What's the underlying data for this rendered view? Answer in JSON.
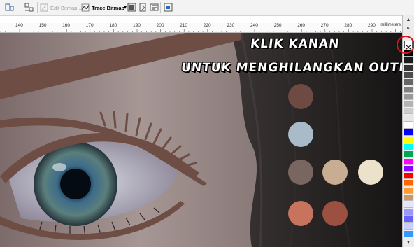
{
  "toolbar": {
    "edit_bitmap_label": "Edit Bitmap...",
    "trace_bitmap_label": "Trace Bitmap"
  },
  "ruler": {
    "labels": [
      "140",
      "150",
      "160",
      "170",
      "180",
      "190",
      "200",
      "210",
      "220",
      "230",
      "240",
      "250",
      "260",
      "270",
      "280",
      "290"
    ],
    "unit": "millimeters"
  },
  "canvas": {
    "headline_line1": "KLIK KANAN",
    "headline_line2": "UNTUK MENGHILANGKAN OUTLINE",
    "swatch_colors": [
      "#6e4a42",
      "#a9bac8",
      "#7a6660",
      "#c8ad93",
      "#ece1cb",
      "#c7735e",
      "#9b5042"
    ],
    "outline_color": "#6e4d44"
  },
  "palette": {
    "colors": [
      "#000000",
      "#1a1a1a",
      "#333333",
      "#4d4d4d",
      "#666666",
      "#808080",
      "#999999",
      "#b3b3b3",
      "#cccccc",
      "#e6e6e6",
      "#ffffff",
      "#0000ff",
      "#ffff00",
      "#00ffff",
      "#00a651",
      "#ff00ff",
      "#8b00ff",
      "#ff0000",
      "#ff6600",
      "#ff9933",
      "#cc9966",
      "#e6e6fa",
      "#9999ff",
      "#6666ff",
      "#ccccff",
      "#3399ff"
    ]
  }
}
